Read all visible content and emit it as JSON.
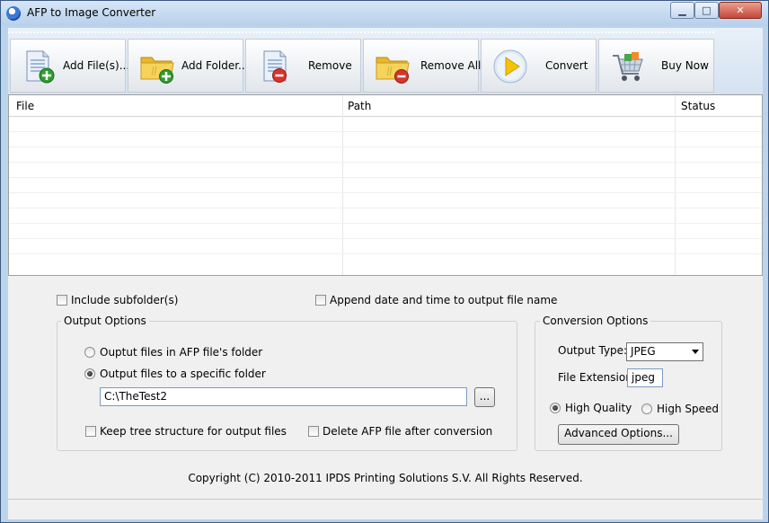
{
  "window": {
    "title": "AFP to Image Converter",
    "controls": {
      "minimize": "▁",
      "maximize": "□",
      "close": "✕"
    }
  },
  "toolbar": {
    "buttons": [
      {
        "label": "Add File(s)...",
        "icon": "add-file-icon"
      },
      {
        "label": "Add Folder...",
        "icon": "add-folder-icon"
      },
      {
        "label": "Remove",
        "icon": "remove-file-icon"
      },
      {
        "label": "Remove All",
        "icon": "remove-all-folder-icon"
      },
      {
        "label": "Convert",
        "icon": "convert-play-icon"
      },
      {
        "label": "Buy Now",
        "icon": "shopping-cart-icon"
      }
    ]
  },
  "file_list": {
    "columns": [
      "File",
      "Path",
      "Status"
    ],
    "rows": []
  },
  "options": {
    "include_subfolders": {
      "label": "Include subfolder(s)",
      "checked": false
    },
    "append_datetime": {
      "label": "Append date and time to output file name",
      "checked": false
    }
  },
  "output_options": {
    "title": "Output Options",
    "radio_afp_folder": {
      "label": "Ouptut files in AFP file's folder",
      "selected": false
    },
    "radio_specific_folder": {
      "label": "Output files to a specific folder",
      "selected": true
    },
    "folder_path": "C:\\TheTest2",
    "browse_label": "...",
    "keep_tree": {
      "label": "Keep tree structure for output files",
      "checked": false
    },
    "delete_afp": {
      "label": "Delete AFP file after conversion",
      "checked": false
    }
  },
  "conversion_options": {
    "title": "Conversion Options",
    "output_type_label": "Output Type:",
    "output_type_value": "JPEG",
    "file_extension_label": "File Extension:",
    "file_extension_value": "jpeg",
    "high_quality": {
      "label": "High Quality",
      "selected": true
    },
    "high_speed": {
      "label": "High Speed",
      "selected": false
    },
    "advanced_button": "Advanced Options..."
  },
  "footer": {
    "copyright": "Copyright (C) 2010-2011 IPDS Printing Solutions S.V.  All Rights Reserved."
  },
  "colors": {
    "title_bar": "#c4d9f0",
    "window_frame": "#bcd3ec",
    "client_bg": "#f0f0f0",
    "close_button": "#c6453a",
    "folder_yellow": "#f2c53d",
    "add_green": "#2f9e2f",
    "remove_red": "#d9342b",
    "play_yellow": "#f5c400"
  }
}
